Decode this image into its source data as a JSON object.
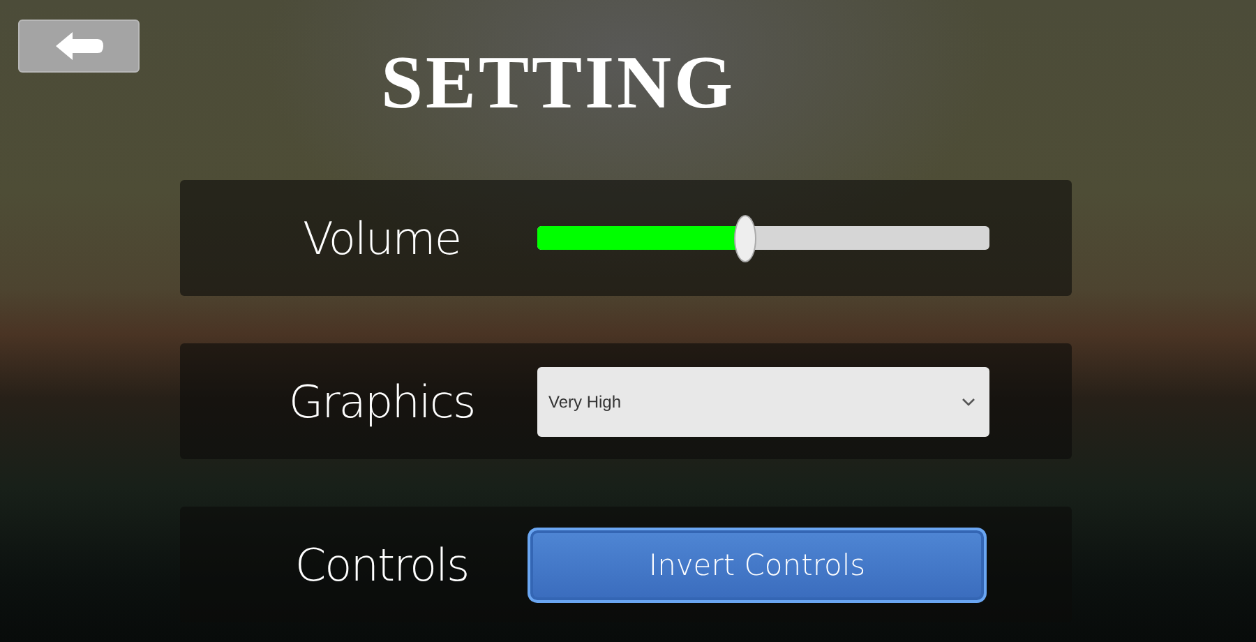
{
  "title": "SETTING",
  "rows": [
    {
      "kind": "slider",
      "label": "Volume",
      "level": 0.46
    },
    {
      "kind": "dropdown",
      "label": "Graphics",
      "value": "Very High"
    },
    {
      "kind": "button",
      "label": "Controls",
      "button": "Invert Controls"
    }
  ]
}
